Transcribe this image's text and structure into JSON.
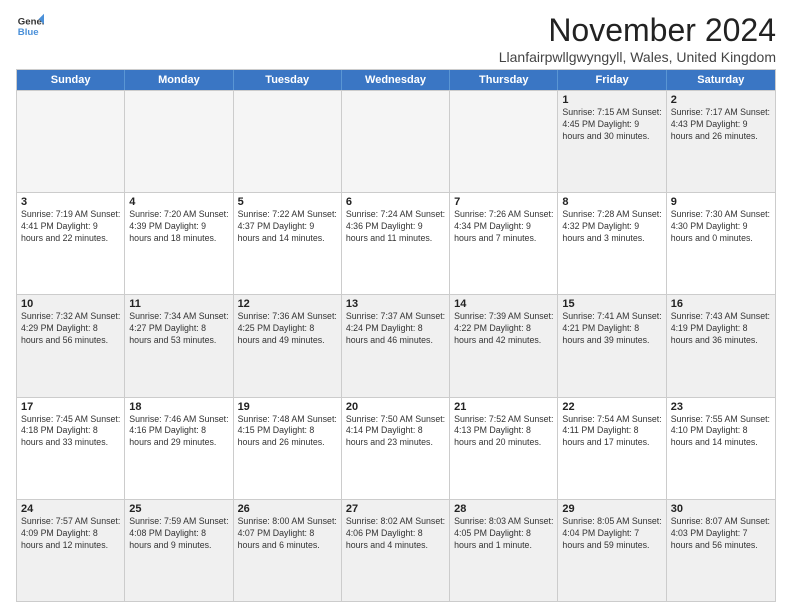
{
  "logo": {
    "line1": "General",
    "line2": "Blue"
  },
  "title": "November 2024",
  "location": "Llanfairpwllgwyngyll, Wales, United Kingdom",
  "days_of_week": [
    "Sunday",
    "Monday",
    "Tuesday",
    "Wednesday",
    "Thursday",
    "Friday",
    "Saturday"
  ],
  "weeks": [
    [
      {
        "day": "",
        "info": "",
        "empty": true
      },
      {
        "day": "",
        "info": "",
        "empty": true
      },
      {
        "day": "",
        "info": "",
        "empty": true
      },
      {
        "day": "",
        "info": "",
        "empty": true
      },
      {
        "day": "",
        "info": "",
        "empty": true
      },
      {
        "day": "1",
        "info": "Sunrise: 7:15 AM\nSunset: 4:45 PM\nDaylight: 9 hours and 30 minutes.",
        "empty": false
      },
      {
        "day": "2",
        "info": "Sunrise: 7:17 AM\nSunset: 4:43 PM\nDaylight: 9 hours and 26 minutes.",
        "empty": false
      }
    ],
    [
      {
        "day": "3",
        "info": "Sunrise: 7:19 AM\nSunset: 4:41 PM\nDaylight: 9 hours and 22 minutes.",
        "empty": false
      },
      {
        "day": "4",
        "info": "Sunrise: 7:20 AM\nSunset: 4:39 PM\nDaylight: 9 hours and 18 minutes.",
        "empty": false
      },
      {
        "day": "5",
        "info": "Sunrise: 7:22 AM\nSunset: 4:37 PM\nDaylight: 9 hours and 14 minutes.",
        "empty": false
      },
      {
        "day": "6",
        "info": "Sunrise: 7:24 AM\nSunset: 4:36 PM\nDaylight: 9 hours and 11 minutes.",
        "empty": false
      },
      {
        "day": "7",
        "info": "Sunrise: 7:26 AM\nSunset: 4:34 PM\nDaylight: 9 hours and 7 minutes.",
        "empty": false
      },
      {
        "day": "8",
        "info": "Sunrise: 7:28 AM\nSunset: 4:32 PM\nDaylight: 9 hours and 3 minutes.",
        "empty": false
      },
      {
        "day": "9",
        "info": "Sunrise: 7:30 AM\nSunset: 4:30 PM\nDaylight: 9 hours and 0 minutes.",
        "empty": false
      }
    ],
    [
      {
        "day": "10",
        "info": "Sunrise: 7:32 AM\nSunset: 4:29 PM\nDaylight: 8 hours and 56 minutes.",
        "empty": false
      },
      {
        "day": "11",
        "info": "Sunrise: 7:34 AM\nSunset: 4:27 PM\nDaylight: 8 hours and 53 minutes.",
        "empty": false
      },
      {
        "day": "12",
        "info": "Sunrise: 7:36 AM\nSunset: 4:25 PM\nDaylight: 8 hours and 49 minutes.",
        "empty": false
      },
      {
        "day": "13",
        "info": "Sunrise: 7:37 AM\nSunset: 4:24 PM\nDaylight: 8 hours and 46 minutes.",
        "empty": false
      },
      {
        "day": "14",
        "info": "Sunrise: 7:39 AM\nSunset: 4:22 PM\nDaylight: 8 hours and 42 minutes.",
        "empty": false
      },
      {
        "day": "15",
        "info": "Sunrise: 7:41 AM\nSunset: 4:21 PM\nDaylight: 8 hours and 39 minutes.",
        "empty": false
      },
      {
        "day": "16",
        "info": "Sunrise: 7:43 AM\nSunset: 4:19 PM\nDaylight: 8 hours and 36 minutes.",
        "empty": false
      }
    ],
    [
      {
        "day": "17",
        "info": "Sunrise: 7:45 AM\nSunset: 4:18 PM\nDaylight: 8 hours and 33 minutes.",
        "empty": false
      },
      {
        "day": "18",
        "info": "Sunrise: 7:46 AM\nSunset: 4:16 PM\nDaylight: 8 hours and 29 minutes.",
        "empty": false
      },
      {
        "day": "19",
        "info": "Sunrise: 7:48 AM\nSunset: 4:15 PM\nDaylight: 8 hours and 26 minutes.",
        "empty": false
      },
      {
        "day": "20",
        "info": "Sunrise: 7:50 AM\nSunset: 4:14 PM\nDaylight: 8 hours and 23 minutes.",
        "empty": false
      },
      {
        "day": "21",
        "info": "Sunrise: 7:52 AM\nSunset: 4:13 PM\nDaylight: 8 hours and 20 minutes.",
        "empty": false
      },
      {
        "day": "22",
        "info": "Sunrise: 7:54 AM\nSunset: 4:11 PM\nDaylight: 8 hours and 17 minutes.",
        "empty": false
      },
      {
        "day": "23",
        "info": "Sunrise: 7:55 AM\nSunset: 4:10 PM\nDaylight: 8 hours and 14 minutes.",
        "empty": false
      }
    ],
    [
      {
        "day": "24",
        "info": "Sunrise: 7:57 AM\nSunset: 4:09 PM\nDaylight: 8 hours and 12 minutes.",
        "empty": false
      },
      {
        "day": "25",
        "info": "Sunrise: 7:59 AM\nSunset: 4:08 PM\nDaylight: 8 hours and 9 minutes.",
        "empty": false
      },
      {
        "day": "26",
        "info": "Sunrise: 8:00 AM\nSunset: 4:07 PM\nDaylight: 8 hours and 6 minutes.",
        "empty": false
      },
      {
        "day": "27",
        "info": "Sunrise: 8:02 AM\nSunset: 4:06 PM\nDaylight: 8 hours and 4 minutes.",
        "empty": false
      },
      {
        "day": "28",
        "info": "Sunrise: 8:03 AM\nSunset: 4:05 PM\nDaylight: 8 hours and 1 minute.",
        "empty": false
      },
      {
        "day": "29",
        "info": "Sunrise: 8:05 AM\nSunset: 4:04 PM\nDaylight: 7 hours and 59 minutes.",
        "empty": false
      },
      {
        "day": "30",
        "info": "Sunrise: 8:07 AM\nSunset: 4:03 PM\nDaylight: 7 hours and 56 minutes.",
        "empty": false
      }
    ]
  ]
}
